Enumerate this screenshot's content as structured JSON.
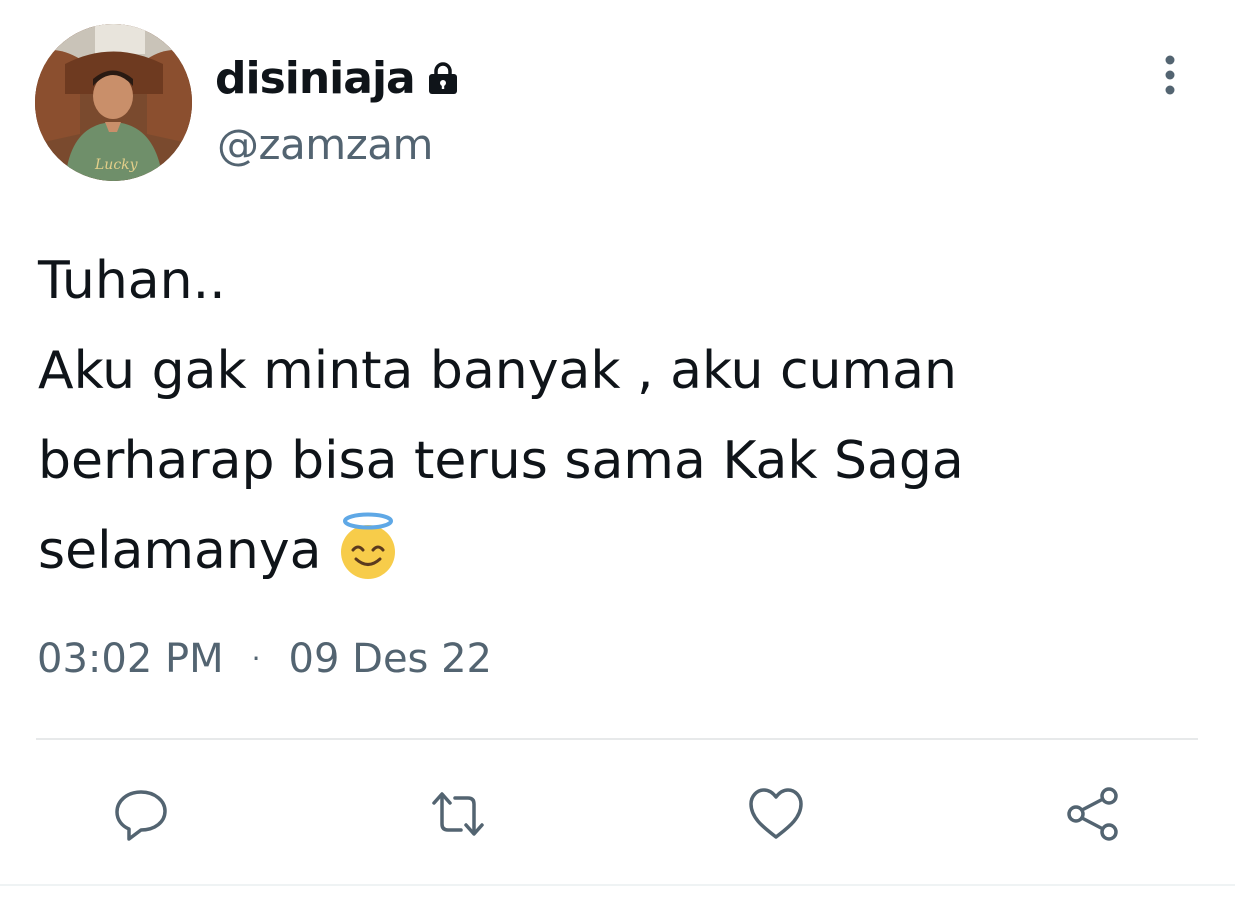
{
  "user": {
    "display_name": "disiniaja",
    "handle": "@zamzam",
    "protected": true
  },
  "tweet": {
    "lines": [
      "Tuhan..",
      "Aku gak minta banyak , aku cuman",
      "berharap bisa terus sama Kak Saga",
      "selamanya"
    ],
    "emoji": "smiling-face-with-halo"
  },
  "meta": {
    "time": "03:02 PM",
    "separator": "·",
    "date": "09 Des 22"
  },
  "icons": {
    "more": "more-vertical-icon",
    "reply": "reply-icon",
    "retweet": "retweet-icon",
    "like": "heart-icon",
    "share": "share-icon",
    "lock": "lock-icon"
  },
  "colors": {
    "text_primary": "#0f1419",
    "text_secondary": "#536471",
    "divider": "#e7e9ea"
  }
}
